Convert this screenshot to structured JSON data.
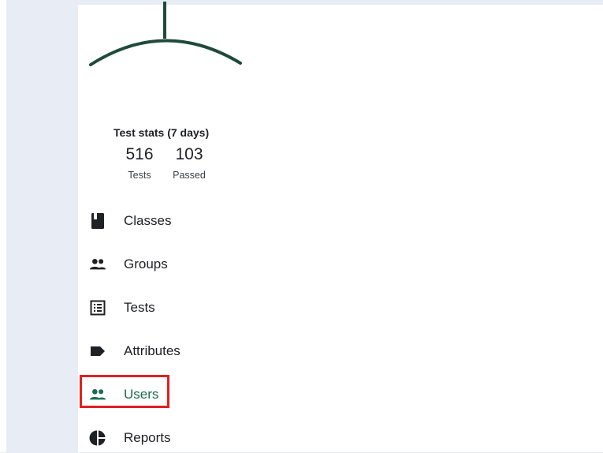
{
  "stats": {
    "title": "Test stats (7 days)",
    "tests": {
      "value": "516",
      "label": "Tests"
    },
    "passed": {
      "value": "103",
      "label": "Passed"
    }
  },
  "nav": {
    "items": [
      {
        "label": "Classes",
        "icon": "book-icon"
      },
      {
        "label": "Groups",
        "icon": "group-icon"
      },
      {
        "label": "Tests",
        "icon": "list-icon"
      },
      {
        "label": "Attributes",
        "icon": "label-tag-icon"
      },
      {
        "label": "Users",
        "icon": "users-icon",
        "active": true
      },
      {
        "label": "Reports",
        "icon": "pie-chart-icon"
      }
    ]
  },
  "colors": {
    "accent": "#1e6b4f",
    "highlight": "#e02020",
    "background": "#e8edf5"
  }
}
